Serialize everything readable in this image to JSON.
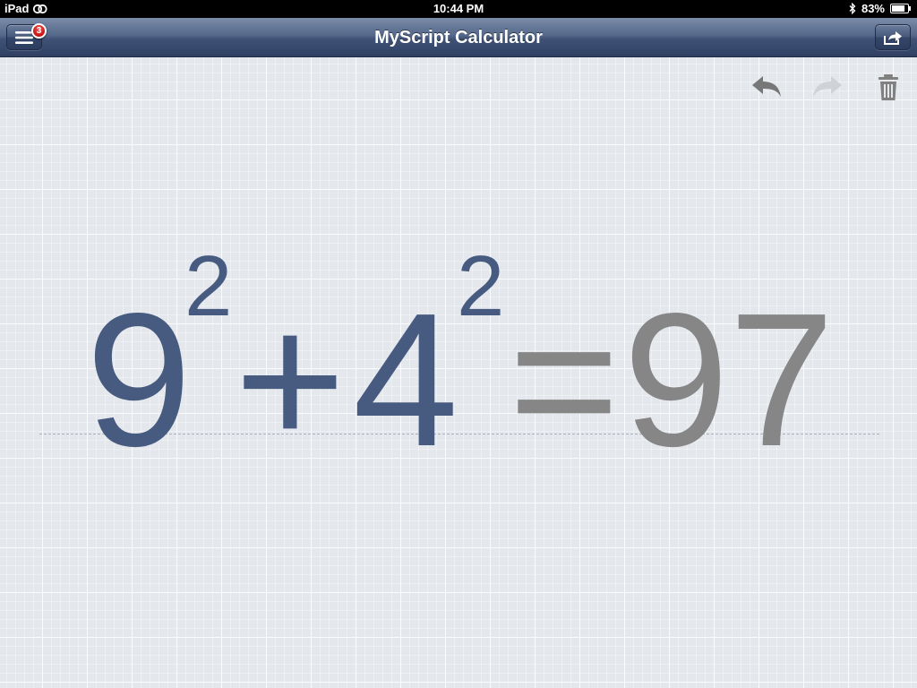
{
  "status_bar": {
    "device": "iPad",
    "time": "10:44 PM",
    "battery": "83%",
    "battery_level": 0.83
  },
  "nav_bar": {
    "title": "MyScript Calculator",
    "menu_badge": "3",
    "menu_icon": "hamburger-menu-icon",
    "share_icon": "share-icon"
  },
  "toolbar": {
    "undo_icon": "undo-arrow-icon",
    "redo_icon": "redo-arrow-icon",
    "trash_icon": "trash-icon",
    "redo_enabled": false
  },
  "expression": {
    "base1": "9",
    "exp1": "2",
    "operator": "+",
    "base2": "4",
    "exp2": "2",
    "equals": "=",
    "result": "97"
  },
  "colors": {
    "ink": "#475b80",
    "result": "#868686",
    "nav_bar": "#3f5275",
    "background": "#e4e7ec"
  }
}
